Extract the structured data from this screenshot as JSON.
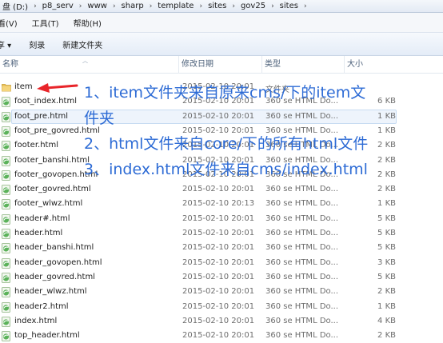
{
  "address_bar": {
    "crumbs": [
      "盘 (D:)",
      "p8_serv",
      "www",
      "sharp",
      "template",
      "sites",
      "gov25",
      "sites"
    ]
  },
  "menu": {
    "items": [
      "看(V)",
      "工具(T)",
      "帮助(H)"
    ]
  },
  "toolbar": {
    "buttons": [
      "共享 ▾",
      "刻录",
      "新建文件夹"
    ]
  },
  "columns": {
    "name": "名称",
    "date": "修改日期",
    "type": "类型",
    "size": "大小"
  },
  "files": [
    {
      "name": "item",
      "date": "2015-02-10 20:01",
      "type": "文件夹",
      "size": "",
      "kind": "folder",
      "selected": false
    },
    {
      "name": "foot_index.html",
      "date": "2015-02-10 20:01",
      "type": "360 se HTML Do...",
      "size": "6 KB",
      "kind": "html",
      "selected": false
    },
    {
      "name": "foot_pre.html",
      "date": "2015-02-10 20:01",
      "type": "360 se HTML Do...",
      "size": "1 KB",
      "kind": "html",
      "selected": true
    },
    {
      "name": "foot_pre_govred.html",
      "date": "2015-02-10 20:01",
      "type": "360 se HTML Do...",
      "size": "1 KB",
      "kind": "html",
      "selected": false
    },
    {
      "name": "footer.html",
      "date": "2015-02-10 20:01",
      "type": "360 se HTML Do...",
      "size": "2 KB",
      "kind": "html",
      "selected": false
    },
    {
      "name": "footer_banshi.html",
      "date": "2015-02-10 20:01",
      "type": "360 se HTML Do...",
      "size": "2 KB",
      "kind": "html",
      "selected": false
    },
    {
      "name": "footer_govopen.html",
      "date": "2015-02-10 20:01",
      "type": "360 se HTML Do...",
      "size": "2 KB",
      "kind": "html",
      "selected": false
    },
    {
      "name": "footer_govred.html",
      "date": "2015-02-10 20:01",
      "type": "360 se HTML Do...",
      "size": "2 KB",
      "kind": "html",
      "selected": false
    },
    {
      "name": "footer_wlwz.html",
      "date": "2015-02-10 20:13",
      "type": "360 se HTML Do...",
      "size": "1 KB",
      "kind": "html",
      "selected": false
    },
    {
      "name": "header#.html",
      "date": "2015-02-10 20:01",
      "type": "360 se HTML Do...",
      "size": "5 KB",
      "kind": "html",
      "selected": false
    },
    {
      "name": "header.html",
      "date": "2015-02-10 20:01",
      "type": "360 se HTML Do...",
      "size": "5 KB",
      "kind": "html",
      "selected": false
    },
    {
      "name": "header_banshi.html",
      "date": "2015-02-10 20:01",
      "type": "360 se HTML Do...",
      "size": "5 KB",
      "kind": "html",
      "selected": false
    },
    {
      "name": "header_govopen.html",
      "date": "2015-02-10 20:01",
      "type": "360 se HTML Do...",
      "size": "3 KB",
      "kind": "html",
      "selected": false
    },
    {
      "name": "header_govred.html",
      "date": "2015-02-10 20:01",
      "type": "360 se HTML Do...",
      "size": "5 KB",
      "kind": "html",
      "selected": false
    },
    {
      "name": "header_wlwz.html",
      "date": "2015-02-10 20:01",
      "type": "360 se HTML Do...",
      "size": "2 KB",
      "kind": "html",
      "selected": false
    },
    {
      "name": "header2.html",
      "date": "2015-02-10 20:01",
      "type": "360 se HTML Do...",
      "size": "1 KB",
      "kind": "html",
      "selected": false
    },
    {
      "name": "index.html",
      "date": "2015-02-10 20:01",
      "type": "360 se HTML Do...",
      "size": "4 KB",
      "kind": "html",
      "selected": false
    },
    {
      "name": "top_header.html",
      "date": "2015-02-10 20:01",
      "type": "360 se HTML Do...",
      "size": "2 KB",
      "kind": "html",
      "selected": false
    }
  ],
  "annotations": {
    "note1_line1": "1、item文件夹来自原来cms/下的item文",
    "note1_line2": "件夹",
    "note2": "2、html文件来自core/下的所有html文件",
    "note3": "3、index.html文件来自cms/index.html"
  },
  "colors": {
    "annotation_text": "#2d6bd5",
    "arrow": "#e8252a",
    "html_icon_bg": "#5bb25a"
  }
}
